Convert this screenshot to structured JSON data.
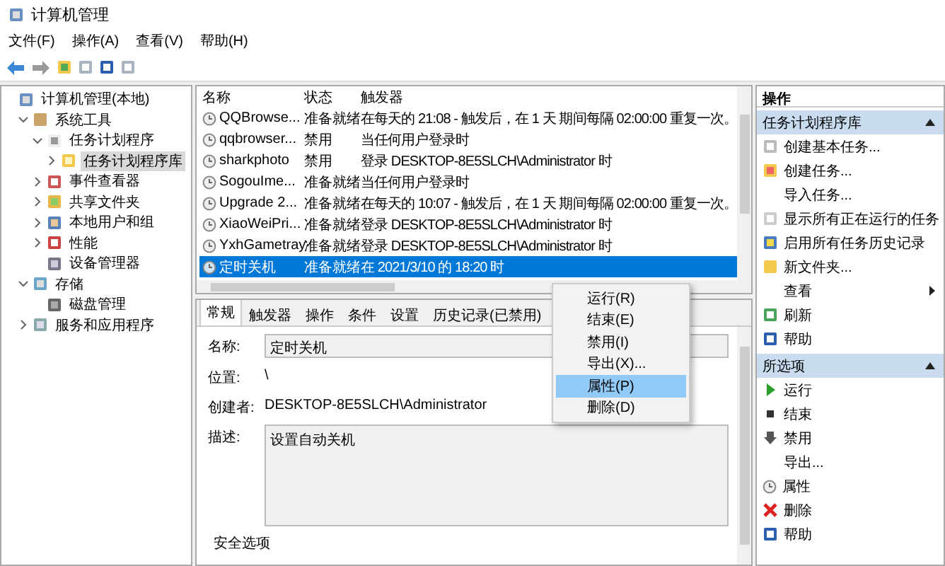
{
  "window": {
    "title": "计算机管理"
  },
  "menu": [
    "文件(F)",
    "操作(A)",
    "查看(V)",
    "帮助(H)"
  ],
  "tree": [
    {
      "label": "计算机管理(本地)",
      "children": [
        {
          "label": "系统工具",
          "expanded": true,
          "children": [
            {
              "label": "任务计划程序",
              "expanded": true,
              "children": [
                {
                  "label": "任务计划程序库",
                  "expanded": false,
                  "selected": true
                }
              ]
            },
            {
              "label": "事件查看器",
              "expanded": false
            },
            {
              "label": "共享文件夹",
              "expanded": false
            },
            {
              "label": "本地用户和组",
              "expanded": false
            },
            {
              "label": "性能",
              "expanded": false
            },
            {
              "label": "设备管理器"
            }
          ]
        },
        {
          "label": "存储",
          "expanded": true,
          "children": [
            {
              "label": "磁盘管理"
            }
          ]
        },
        {
          "label": "服务和应用程序",
          "expanded": false
        }
      ]
    }
  ],
  "task_list": {
    "columns": [
      "名称",
      "状态",
      "触发器"
    ],
    "rows": [
      {
        "name": "QQBrowse...",
        "status": "准备就绪",
        "trigger": "在每天的 21:08 - 触发后，在 1 天 期间每隔 02:00:00 重复一次。",
        "selected": false
      },
      {
        "name": "qqbrowser...",
        "status": "禁用",
        "trigger": "当任何用户登录时",
        "selected": false
      },
      {
        "name": "sharkphoto",
        "status": "禁用",
        "trigger": "登录 DESKTOP-8E5SLCH\\Administrator 时",
        "selected": false
      },
      {
        "name": "SogouIme...",
        "status": "准备就绪",
        "trigger": "当任何用户登录时",
        "selected": false
      },
      {
        "name": "Upgrade 2...",
        "status": "准备就绪",
        "trigger": "在每天的 10:07 - 触发后，在 1 天 期间每隔 02:00:00 重复一次。",
        "selected": false
      },
      {
        "name": "XiaoWeiPri...",
        "status": "准备就绪",
        "trigger": "登录 DESKTOP-8E5SLCH\\Administrator 时",
        "selected": false
      },
      {
        "name": "YxhGametray",
        "status": "准备就绪",
        "trigger": "登录 DESKTOP-8E5SLCH\\Administrator 时",
        "selected": false
      },
      {
        "name": "定时关机",
        "status": "准备就绪",
        "trigger": "在 2021/3/10 的 18:20 时",
        "selected": true
      }
    ]
  },
  "details": {
    "tabs": [
      {
        "label": "常规",
        "selected": true
      },
      {
        "label": "触发器",
        "selected": false
      },
      {
        "label": "操作",
        "selected": false
      },
      {
        "label": "条件",
        "selected": false
      },
      {
        "label": "设置",
        "selected": false
      },
      {
        "label": "历史记录(已禁用)",
        "selected": false
      }
    ],
    "name_label": "名称:",
    "name_value": "定时关机",
    "location_label": "位置:",
    "location_value": "\\",
    "author_label": "创建者:",
    "author_value": "DESKTOP-8E5SLCH\\Administrator",
    "description_label": "描述:",
    "description_value": "设置自动关机",
    "security_heading": "安全选项"
  },
  "context_menu": [
    {
      "label": "运行(R)",
      "selected": false
    },
    {
      "label": "结束(E)",
      "selected": false
    },
    {
      "label": "禁用(I)",
      "selected": false
    },
    {
      "label": "导出(X)...",
      "selected": false
    },
    {
      "label": "属性(P)",
      "selected": true
    },
    {
      "label": "删除(D)",
      "selected": false
    }
  ],
  "actions": {
    "header": "操作",
    "sections": [
      {
        "title": "任务计划程序库",
        "expanded": true,
        "items": [
          {
            "label": "创建基本任务..."
          },
          {
            "label": "创建任务..."
          },
          {
            "label": "导入任务..."
          },
          {
            "label": "显示所有正在运行的任务"
          },
          {
            "label": "启用所有任务历史记录"
          },
          {
            "label": "新文件夹..."
          },
          {
            "label": "查看",
            "submenu": true
          },
          {
            "label": "刷新"
          },
          {
            "label": "帮助"
          }
        ]
      },
      {
        "title": "所选项",
        "expanded": true,
        "items": [
          {
            "label": "运行"
          },
          {
            "label": "结束"
          },
          {
            "label": "禁用"
          },
          {
            "label": "导出..."
          },
          {
            "label": "属性"
          },
          {
            "label": "删除"
          },
          {
            "label": "帮助"
          }
        ]
      }
    ]
  }
}
